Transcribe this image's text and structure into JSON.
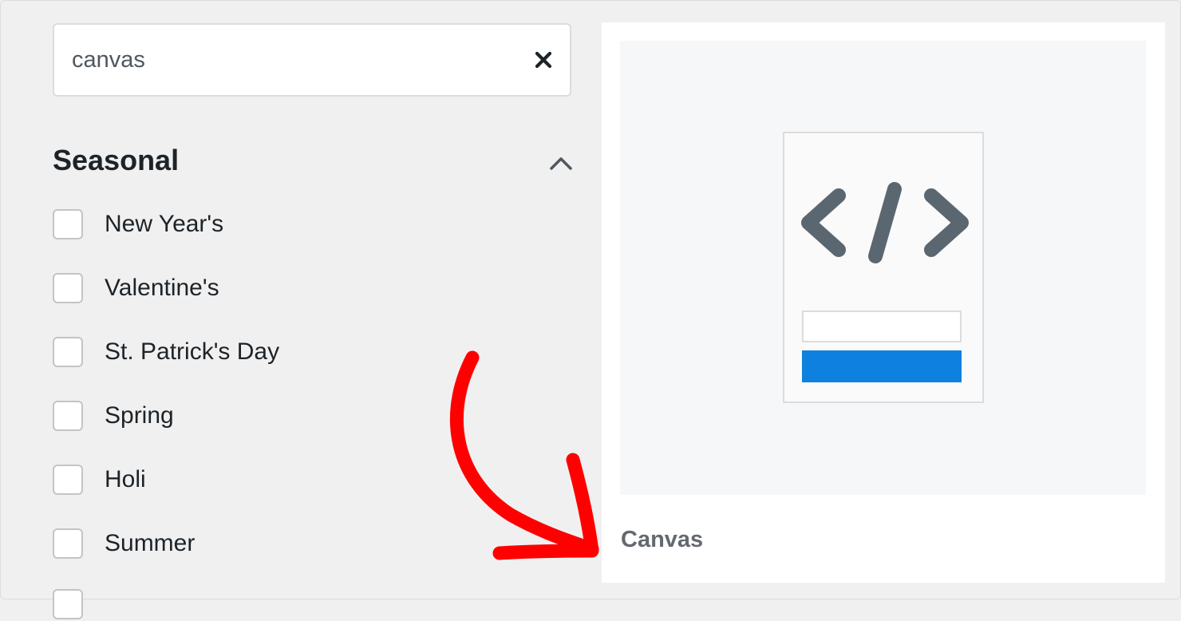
{
  "search": {
    "value": "canvas",
    "clear_icon": "close-icon"
  },
  "filters": {
    "section_title": "Seasonal",
    "collapse_icon": "chevron-up-icon",
    "options": [
      {
        "label": "New Year's",
        "checked": false
      },
      {
        "label": "Valentine's",
        "checked": false
      },
      {
        "label": "St. Patrick's Day",
        "checked": false
      },
      {
        "label": "Spring",
        "checked": false
      },
      {
        "label": "Holi",
        "checked": false
      },
      {
        "label": "Summer",
        "checked": false
      }
    ]
  },
  "template_card": {
    "title": "Canvas",
    "preview_icon": "code-icon",
    "accent_color": "#0e80e0"
  },
  "annotation": {
    "arrow_color": "#ff0000",
    "arrow_icon": "curved-arrow-icon"
  }
}
